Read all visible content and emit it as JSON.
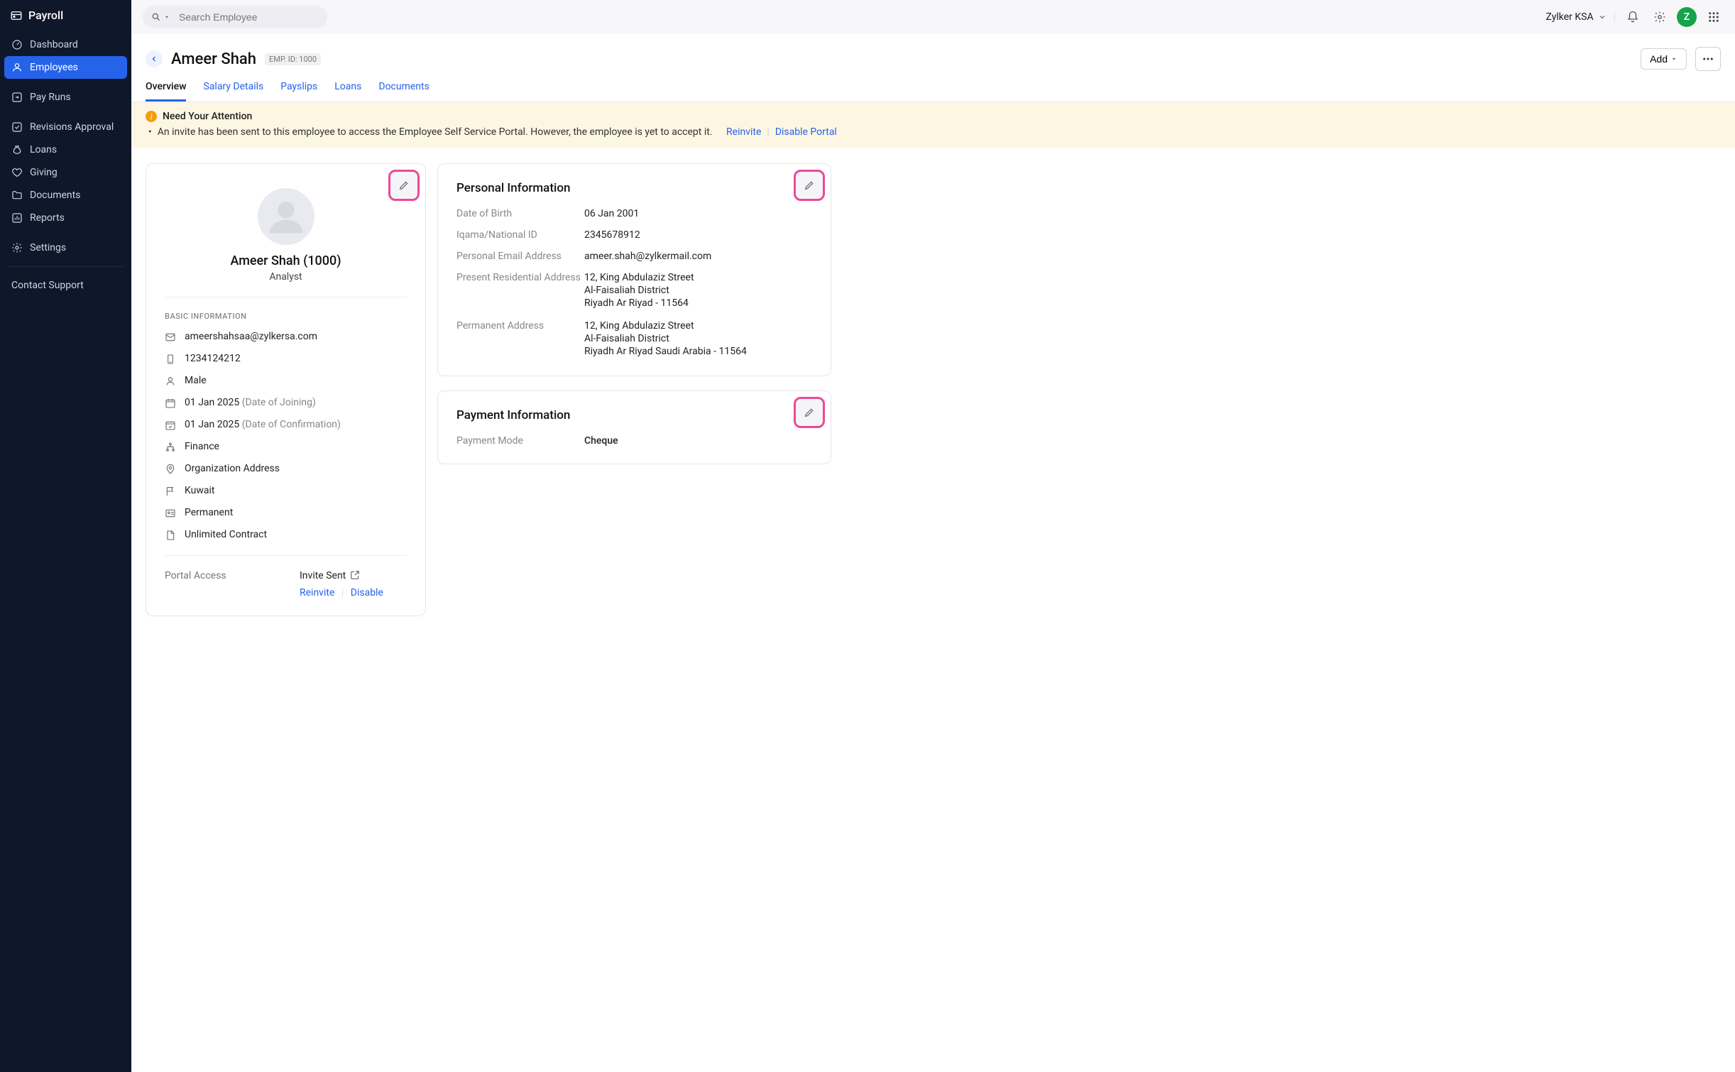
{
  "brand": "Payroll",
  "sidebar": {
    "items": [
      {
        "label": "Dashboard"
      },
      {
        "label": "Employees"
      },
      {
        "label": "Pay Runs"
      },
      {
        "label": "Revisions Approval"
      },
      {
        "label": "Loans"
      },
      {
        "label": "Giving"
      },
      {
        "label": "Documents"
      },
      {
        "label": "Reports"
      },
      {
        "label": "Settings"
      }
    ],
    "support": "Contact Support"
  },
  "topbar": {
    "search_placeholder": "Search Employee",
    "org_name": "Zylker KSA",
    "avatar_letter": "Z"
  },
  "page": {
    "title": "Ameer Shah",
    "emp_id_label": "EMP. ID: 1000",
    "add_label": "Add",
    "tabs": [
      {
        "label": "Overview"
      },
      {
        "label": "Salary Details"
      },
      {
        "label": "Payslips"
      },
      {
        "label": "Loans"
      },
      {
        "label": "Documents"
      }
    ]
  },
  "alert": {
    "title": "Need Your Attention",
    "bullet": "•",
    "message": "An invite has been sent to this employee to access the Employee Self Service Portal. However, the employee is yet to accept it.",
    "reinvite": "Reinvite",
    "disable": "Disable Portal"
  },
  "profile": {
    "name_id": "Ameer Shah (1000)",
    "role": "Analyst",
    "section_label": "BASIC INFORMATION",
    "email": "ameershahsaa@zylkersa.com",
    "phone": "1234124212",
    "gender": "Male",
    "doj_date": "01 Jan 2025",
    "doj_note": "(Date of Joining)",
    "doc_date": "01 Jan 2025",
    "doc_note": "(Date of Confirmation)",
    "department": "Finance",
    "location": "Organization Address",
    "country": "Kuwait",
    "emp_type": "Permanent",
    "contract": "Unlimited Contract",
    "portal_label": "Portal Access",
    "portal_status": "Invite Sent",
    "portal_reinvite": "Reinvite",
    "portal_disable": "Disable"
  },
  "personal": {
    "title": "Personal Information",
    "dob_label": "Date of Birth",
    "dob": "06 Jan 2001",
    "natid_label": "Iqama/National ID",
    "natid": "2345678912",
    "pemail_label": "Personal Email Address",
    "pemail": "ameer.shah@zylkermail.com",
    "presaddr_label": "Present Residential Address",
    "presaddr_l1": "12, King Abdulaziz Street",
    "presaddr_l2": "Al-Faisaliah District",
    "presaddr_l3": "Riyadh  Ar Riyad  - 11564",
    "permaddr_label": "Permanent Address",
    "permaddr_l1": "12, King Abdulaziz Street",
    "permaddr_l2": "Al-Faisaliah District",
    "permaddr_l3": "Riyadh  Ar Riyad  Saudi Arabia  - 11564"
  },
  "payment": {
    "title": "Payment Information",
    "mode_label": "Payment Mode",
    "mode": "Cheque"
  }
}
